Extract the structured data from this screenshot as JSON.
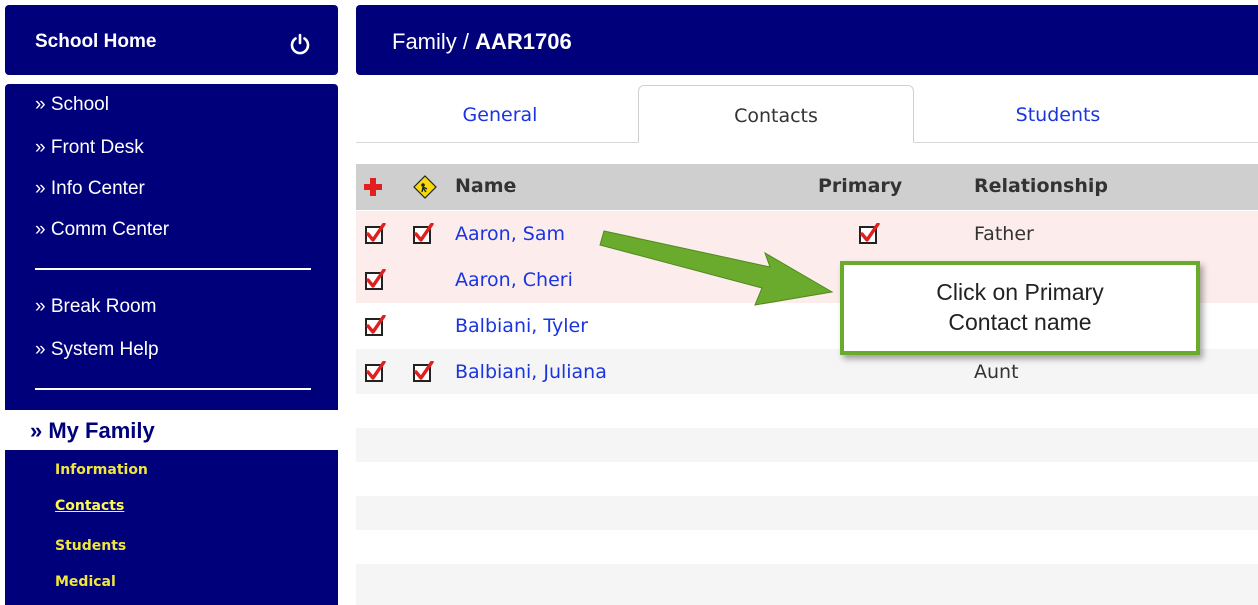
{
  "sidebar": {
    "home_title": "School Home",
    "links": [
      "» School",
      "» Front Desk",
      "» Info Center",
      "» Comm Center",
      "» Break Room",
      "» System Help"
    ],
    "section_title": "» My Family",
    "sub_links": [
      "Information",
      "Contacts",
      "Students",
      "Medical"
    ]
  },
  "header": {
    "crumb_prefix": "Family /",
    "family_id": "AAR1706"
  },
  "tabs": [
    {
      "label": "General",
      "active": false
    },
    {
      "label": "Contacts",
      "active": true
    },
    {
      "label": "Students",
      "active": false
    }
  ],
  "table": {
    "columns": {
      "name": "Name",
      "primary": "Primary",
      "relationship": "Relationship"
    },
    "rows": [
      {
        "name": "Aaron, Sam",
        "relationship": "Father",
        "emergency": true,
        "pickup": true,
        "primary": true
      },
      {
        "name": "Aaron, Cheri",
        "relationship": "",
        "emergency": true,
        "pickup": false,
        "primary": false
      },
      {
        "name": "Balbiani, Tyler",
        "relationship": "",
        "emergency": true,
        "pickup": false,
        "primary": false
      },
      {
        "name": "Balbiani, Juliana",
        "relationship": "Aunt",
        "emergency": true,
        "pickup": true,
        "primary": false
      }
    ]
  },
  "callout": {
    "line1": "Click on Primary",
    "line2": "Contact name"
  },
  "colors": {
    "navy": "#00007a",
    "link_blue": "#1a35e0",
    "sub_link_yellow": "#f0e63c",
    "callout_green": "#6aab2e",
    "check_red": "#e0201e"
  }
}
